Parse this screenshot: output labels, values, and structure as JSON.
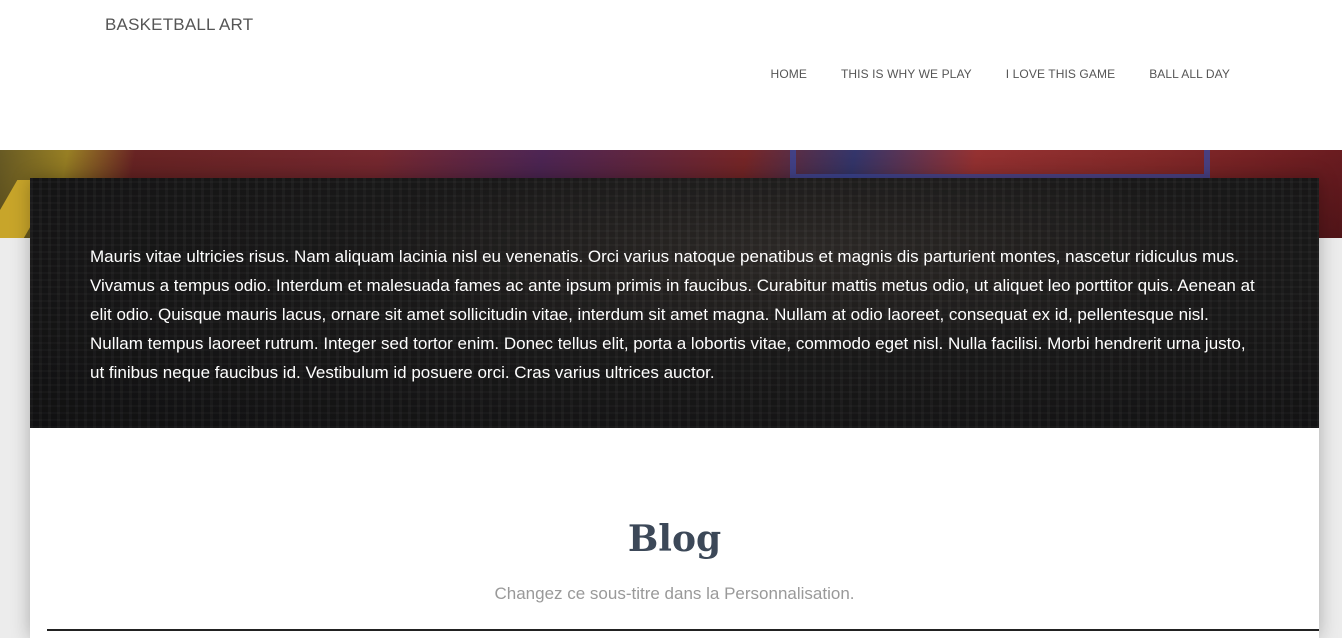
{
  "header": {
    "brand": "BASKETBALL ART",
    "nav": [
      "HOME",
      "THIS IS WHY WE PLAY",
      "I LOVE THIS GAME",
      "BALL ALL DAY"
    ]
  },
  "intro": {
    "text": "Mauris vitae ultricies risus. Nam aliquam lacinia nisl eu venenatis. Orci varius natoque penatibus et magnis dis parturient montes, nascetur ridiculus mus. Vivamus a tempus odio. Interdum et malesuada fames ac ante ipsum primis in faucibus. Curabitur mattis metus odio, ut aliquet leo porttitor quis. Aenean at elit odio. Quisque mauris lacus, ornare sit amet sollicitudin vitae, interdum sit amet magna. Nullam at odio laoreet, consequat ex id, pellentesque nisl. Nullam tempus laoreet rutrum. Integer sed tortor enim. Donec tellus elit, porta a lobortis vitae, commodo eget nisl. Nulla facilisi. Morbi hendrerit urna justo, ut finibus neque faucibus id. Vestibulum id posuere orci. Cras varius ultrices auctor."
  },
  "blog": {
    "title": "Blog",
    "subtitle": "Changez ce sous-titre dans la Personnalisation."
  },
  "colors": {
    "title": "#3c4858",
    "subtitle": "#999999",
    "nav_text": "#555555"
  }
}
